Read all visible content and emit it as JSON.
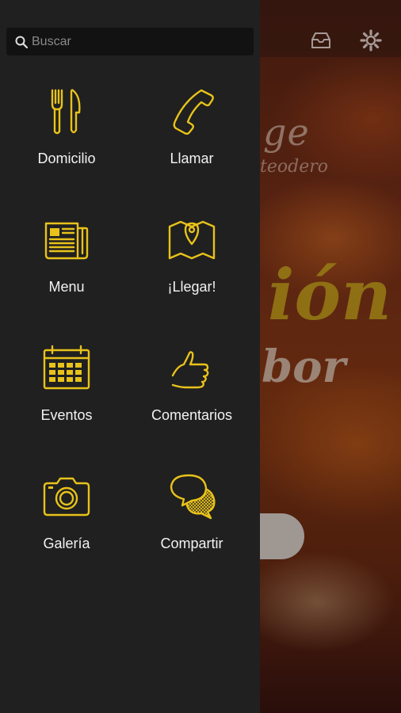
{
  "app": {
    "accent_color": "#e8c21a",
    "drawer_color": "#202020"
  },
  "search": {
    "placeholder": "Buscar",
    "icon": "search-icon"
  },
  "menu": {
    "items": [
      {
        "label": "Domicilio",
        "icon": "fork-knife-icon"
      },
      {
        "label": "Llamar",
        "icon": "phone-icon"
      },
      {
        "label": "Menu",
        "icon": "newspaper-icon"
      },
      {
        "label": "¡Llegar!",
        "icon": "map-pin-icon"
      },
      {
        "label": "Eventos",
        "icon": "calendar-icon"
      },
      {
        "label": "Comentarios",
        "icon": "thumbs-up-icon"
      },
      {
        "label": "Galería",
        "icon": "camera-icon"
      },
      {
        "label": "Compartir",
        "icon": "chat-bubbles-icon"
      }
    ]
  },
  "background": {
    "topbar_icons": [
      "inbox-icon",
      "gear-icon"
    ],
    "brand_fragment": "ge",
    "brand_sub_fragment": "teodero",
    "script_fragment_1": "ión",
    "script_fragment_2": "bor"
  }
}
